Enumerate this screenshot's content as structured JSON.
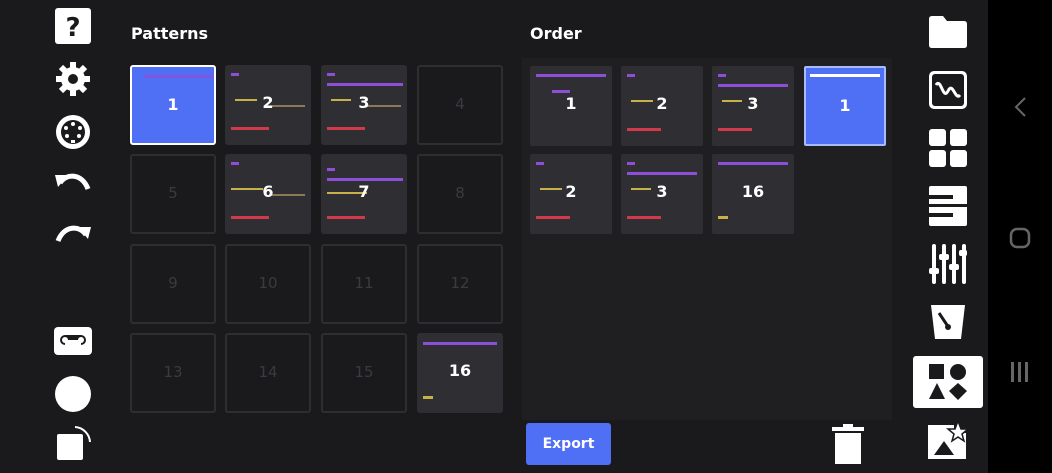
{
  "patterns": {
    "title": "Patterns",
    "cells": [
      "1",
      "2",
      "3",
      "4",
      "5",
      "6",
      "7",
      "8",
      "9",
      "10",
      "11",
      "12",
      "13",
      "14",
      "15",
      "16"
    ]
  },
  "order": {
    "title": "Order",
    "items": [
      "1",
      "2",
      "3",
      "1",
      "2",
      "3",
      "16"
    ]
  },
  "export_label": "Export",
  "colors": {
    "accent": "#4f6ff5",
    "purple": "#8e4fd8",
    "red": "#d03a4a",
    "yellow": "#c8b04a"
  }
}
